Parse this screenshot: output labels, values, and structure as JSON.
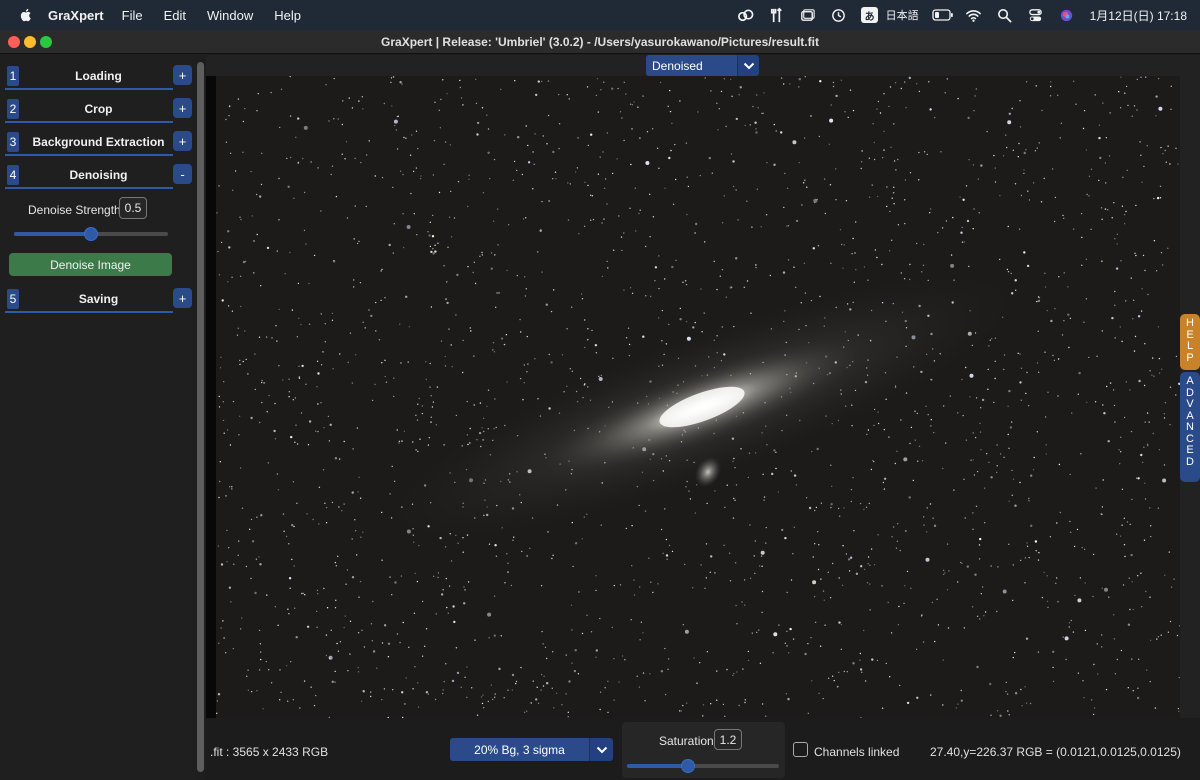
{
  "menubar": {
    "app_name": "GraXpert",
    "menus": [
      "File",
      "Edit",
      "Window",
      "Help"
    ],
    "ime_glyph": "あ",
    "ime_label": "日本語",
    "clock": "1月12日(日)  17:18",
    "tray_icons": [
      "creative-cloud-icon",
      "tools-icon",
      "window-stack-icon",
      "time-machine-icon",
      "input-method-icon",
      "battery-icon",
      "wifi-icon",
      "spotlight-icon",
      "control-center-icon",
      "siri-icon"
    ]
  },
  "window": {
    "title": "GraXpert | Release: 'Umbriel' (3.0.2) - /Users/yasurokawano/Pictures/result.fit"
  },
  "sidebar": {
    "sections": [
      {
        "number": "1",
        "label": "Loading",
        "toggle": "+"
      },
      {
        "number": "2",
        "label": "Crop",
        "toggle": "+"
      },
      {
        "number": "3",
        "label": "Background Extraction",
        "toggle": "+"
      },
      {
        "number": "4",
        "label": "Denoising",
        "toggle": "-"
      },
      {
        "number": "5",
        "label": "Saving",
        "toggle": "+"
      }
    ],
    "denoise": {
      "strength_label": "Denoise Strength",
      "strength_value": "0.5",
      "strength_fraction": 0.5,
      "button_label": "Denoise Image"
    }
  },
  "viewer": {
    "display_selected": "Denoised",
    "side_tabs": {
      "help": "HELP",
      "advanced": "ADVANCED"
    }
  },
  "statusbar": {
    "image_info": ".fit : 3565 x 2433 RGB",
    "stretch_selected": "20% Bg, 3 sigma",
    "saturation_label": "Saturation",
    "saturation_value": "1.2",
    "saturation_fraction": 0.4,
    "channels_linked_label": "Channels linked",
    "channels_linked": false,
    "coords_readout": "27.40,y=226.37  RGB = (0.0121,0.0125,0.0125)"
  },
  "colors": {
    "accent_blue": "#2a4a8a",
    "denoise_green": "#3d7a4a",
    "help_orange": "#c8822a"
  }
}
